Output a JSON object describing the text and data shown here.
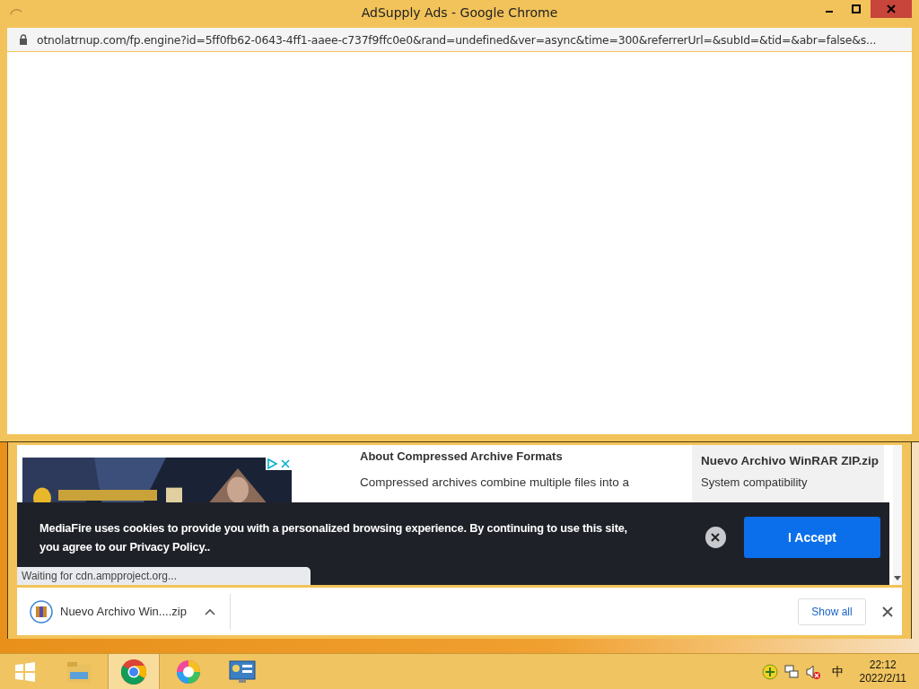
{
  "popup": {
    "title": "AdSupply Ads - Google Chrome",
    "url": "otnolatrnup.com/fp.engine?id=5ff0fb62-0643-4ff1-aaee-c737f9ffc0e0&rand=undefined&ver=async&time=300&referrerUrl=&subId=&tid=&abr=false&s..."
  },
  "page": {
    "article": {
      "heading": "About Compressed Archive Formats",
      "text": "Compressed archives combine multiple files into a"
    },
    "sidebar": {
      "title": "Nuevo Archivo WinRAR ZIP.zip",
      "subtitle": "System compatibility"
    },
    "cookie_banner": {
      "text": "MediaFire uses cookies to provide you with a personalized browsing experience. By continuing to use this site, you agree to our Privacy Policy..",
      "button": "I Accept"
    },
    "status": "Waiting for cdn.ampproject.org..."
  },
  "download_bar": {
    "file": "Nuevo Archivo Win....zip",
    "show_all": "Show all"
  },
  "taskbar": {
    "apps": [
      {
        "kind": "start",
        "selected": false
      },
      {
        "kind": "explorer",
        "selected": false
      },
      {
        "kind": "chrome",
        "selected": true
      },
      {
        "kind": "paint",
        "selected": false
      },
      {
        "kind": "control",
        "selected": false
      }
    ],
    "ime": "中",
    "time": "22:12",
    "date": "2022/2/11"
  }
}
